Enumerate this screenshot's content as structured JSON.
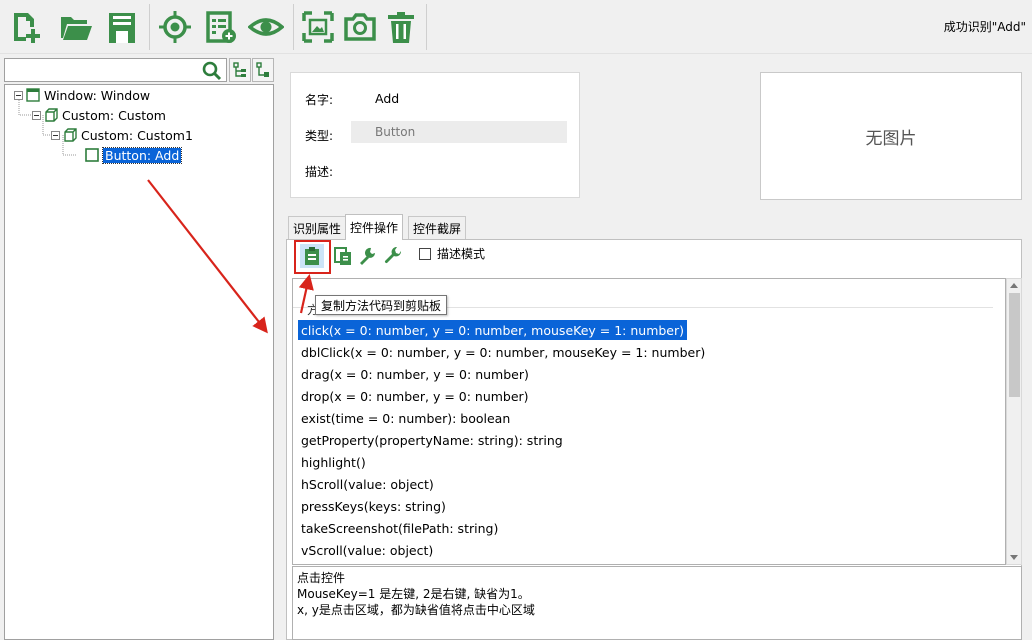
{
  "toolbar": {
    "buttons": [
      {
        "name": "new-file-icon"
      },
      {
        "name": "open-folder-icon"
      },
      {
        "name": "save-icon"
      },
      {
        "name": "target-icon"
      },
      {
        "name": "list-add-icon"
      },
      {
        "name": "eye-icon"
      },
      {
        "name": "capture-frame-icon"
      },
      {
        "name": "camera-icon"
      },
      {
        "name": "trash-icon"
      }
    ],
    "status": "成功识别\"Add\""
  },
  "tree": {
    "search_value": "",
    "nodes": [
      {
        "label": "Window: Window"
      },
      {
        "label": "Custom: Custom"
      },
      {
        "label": "Custom: Custom1"
      },
      {
        "label": "Button: Add"
      }
    ]
  },
  "info": {
    "name_label": "名字:",
    "name_value": "Add",
    "type_label": "类型:",
    "type_value": "Button",
    "desc_label": "描述:"
  },
  "image_placeholder": "无图片",
  "tabs": [
    {
      "label": "识别属性"
    },
    {
      "label": "控件操作"
    },
    {
      "label": "控件截屏"
    }
  ],
  "methods_toolbar": {
    "desc_mode_label": "描述模式",
    "desc_mode_checked": false,
    "tooltip": "复制方法代码到剪贴板"
  },
  "methods": {
    "header": "方",
    "items": [
      "click(x = 0: number, y = 0: number, mouseKey = 1: number)",
      "dblClick(x = 0: number, y = 0: number, mouseKey = 1: number)",
      "drag(x = 0: number, y = 0: number)",
      "drop(x = 0: number, y = 0: number)",
      "exist(time = 0: number): boolean",
      "getProperty(propertyName: string): string",
      "highlight()",
      "hScroll(value: object)",
      "pressKeys(keys: string)",
      "takeScreenshot(filePath: string)",
      "vScroll(value: object)"
    ],
    "selected_index": 0
  },
  "description": {
    "lines": [
      "点击控件",
      "MouseKey=1 是左键, 2是右键, 缺省为1。",
      "x, y是点击区域，都为缺省值将点击中心区域"
    ]
  },
  "colors": {
    "icon_green": "#3c8f4a",
    "selection_blue": "#0a64d8",
    "annotation_red": "#d8241b"
  }
}
